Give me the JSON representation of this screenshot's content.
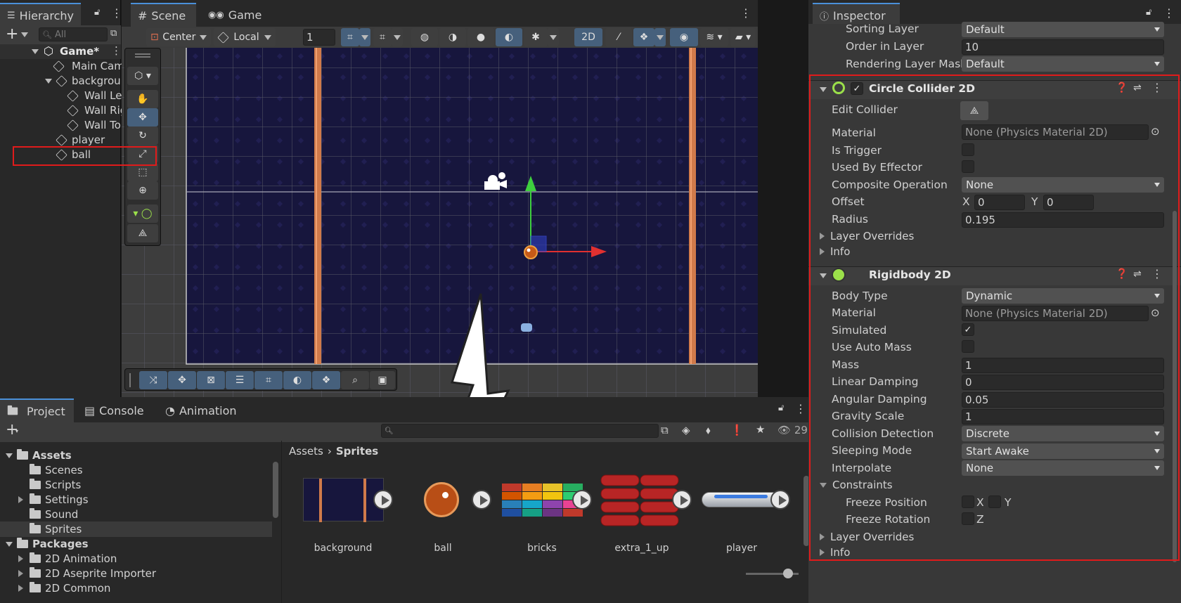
{
  "tabs": {
    "hierarchy": "Hierarchy",
    "scene": "Scene",
    "game": "Game",
    "inspector": "Inspector",
    "project": "Project",
    "console": "Console",
    "animation": "Animation"
  },
  "hierarchy": {
    "search_placeholder": "All",
    "items": [
      {
        "label": "Game*",
        "depth": 0
      },
      {
        "label": "Main Came",
        "depth": 1
      },
      {
        "label": "backgroun",
        "depth": 1
      },
      {
        "label": "Wall Left",
        "depth": 2
      },
      {
        "label": "Wall Righ",
        "depth": 2
      },
      {
        "label": "Wall Top",
        "depth": 2
      },
      {
        "label": "player",
        "depth": 1
      },
      {
        "label": "ball",
        "depth": 1
      }
    ]
  },
  "scene_toolbar": {
    "pivot": "Center",
    "space": "Local",
    "snap_value": "1",
    "mode_2d": "2D"
  },
  "inspector": {
    "sorting_layer": {
      "label": "Sorting Layer",
      "value": "Default"
    },
    "order_in_layer": {
      "label": "Order in Layer",
      "value": "10"
    },
    "rendering_layer_mask": {
      "label": "Rendering Layer Mask",
      "value": "Default"
    },
    "circle_collider": {
      "title": "Circle Collider 2D",
      "edit_collider": "Edit Collider",
      "material": {
        "label": "Material",
        "value": "None (Physics Material 2D)"
      },
      "is_trigger": "Is Trigger",
      "used_by_effector": "Used By Effector",
      "composite_operation": {
        "label": "Composite Operation",
        "value": "None"
      },
      "offset": {
        "label": "Offset",
        "x_label": "X",
        "x": "0",
        "y_label": "Y",
        "y": "0"
      },
      "radius": {
        "label": "Radius",
        "value": "0.195"
      },
      "layer_overrides": "Layer Overrides",
      "info": "Info"
    },
    "rigidbody": {
      "title": "Rigidbody 2D",
      "body_type": {
        "label": "Body Type",
        "value": "Dynamic"
      },
      "material": {
        "label": "Material",
        "value": "None (Physics Material 2D)"
      },
      "simulated": "Simulated",
      "use_auto_mass": "Use Auto Mass",
      "mass": {
        "label": "Mass",
        "value": "1"
      },
      "linear_damping": {
        "label": "Linear Damping",
        "value": "0"
      },
      "angular_damping": {
        "label": "Angular Damping",
        "value": "0.05"
      },
      "gravity_scale": {
        "label": "Gravity Scale",
        "value": "1"
      },
      "collision_detection": {
        "label": "Collision Detection",
        "value": "Discrete"
      },
      "sleeping_mode": {
        "label": "Sleeping Mode",
        "value": "Start Awake"
      },
      "interpolate": {
        "label": "Interpolate",
        "value": "None"
      },
      "constraints": "Constraints",
      "freeze_position": {
        "label": "Freeze Position",
        "x": "X",
        "y": "Y"
      },
      "freeze_rotation": {
        "label": "Freeze Rotation",
        "z": "Z"
      },
      "layer_overrides": "Layer Overrides",
      "info": "Info"
    }
  },
  "project": {
    "hidden_count": "29",
    "breadcrumb_root": "Assets",
    "breadcrumb_current": "Sprites",
    "tree": [
      {
        "label": "Assets",
        "bold": true
      },
      {
        "label": "Scenes"
      },
      {
        "label": "Scripts"
      },
      {
        "label": "Settings"
      },
      {
        "label": "Sound"
      },
      {
        "label": "Sprites"
      },
      {
        "label": "Packages",
        "bold": true
      },
      {
        "label": "2D Animation"
      },
      {
        "label": "2D Aseprite Importer"
      },
      {
        "label": "2D Common"
      }
    ],
    "assets": [
      "background",
      "ball",
      "bricks",
      "extra_1_up",
      "player"
    ]
  },
  "colors": {
    "accent": "#4a90d9",
    "highlight_box": "#e01b1b",
    "scene_bg": "#17163d"
  }
}
